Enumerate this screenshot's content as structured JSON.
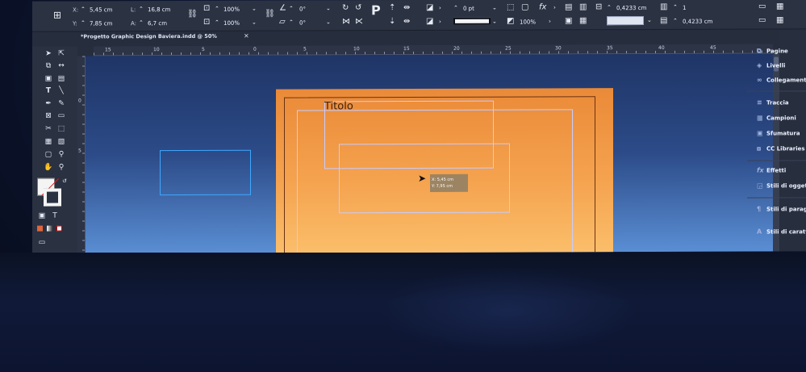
{
  "control_bar": {
    "x_label": "X:",
    "x_value": "5,45 cm",
    "y_label": "Y:",
    "y_value": "7,85 cm",
    "w_label": "L:",
    "w_value": "16,8 cm",
    "h_label": "A:",
    "h_value": "6,7 cm",
    "scale_x": "100%",
    "scale_y": "100%",
    "rotate": "0°",
    "shear": "0°",
    "stroke_weight": "0 pt",
    "opacity": "100%",
    "offset_a": "0,4233 cm",
    "offset_b": "0,4233 cm",
    "columns": "1"
  },
  "document_tab": {
    "label": "*Progetto Graphic Design Baviera.indd @ 50%"
  },
  "ruler": {
    "h_ticks": [
      "15",
      "10",
      "5",
      "0",
      "5",
      "10",
      "15",
      "20",
      "25",
      "30",
      "35",
      "40",
      "45"
    ],
    "v_ticks": [
      "0",
      "5"
    ]
  },
  "canvas": {
    "title_text": "Titolo",
    "tooltip_x": "X: 5,45 cm",
    "tooltip_y": "Y: 7,95 cm",
    "page_color": "#f09a45",
    "pasteboard_color": "#2c4b88",
    "selection_color": "#3fa8ff"
  },
  "panels": {
    "items": [
      {
        "label": "Pagine",
        "icon": "pages-icon"
      },
      {
        "label": "Livelli",
        "icon": "layers-icon"
      },
      {
        "label": "Collegamenti",
        "icon": "links-icon"
      },
      {
        "label": "Traccia",
        "icon": "stroke-icon"
      },
      {
        "label": "Campioni",
        "icon": "swatches-icon"
      },
      {
        "label": "Sfumatura",
        "icon": "gradient-icon"
      },
      {
        "label": "CC Libraries",
        "icon": "cc-libraries-icon"
      },
      {
        "label": "Effetti",
        "icon": "effects-icon"
      },
      {
        "label": "Stili di oggetto",
        "icon": "object-styles-icon"
      },
      {
        "label": "Stili di paragrafo",
        "icon": "paragraph-styles-icon"
      },
      {
        "label": "Stili di carattere",
        "icon": "character-styles-icon"
      }
    ]
  }
}
